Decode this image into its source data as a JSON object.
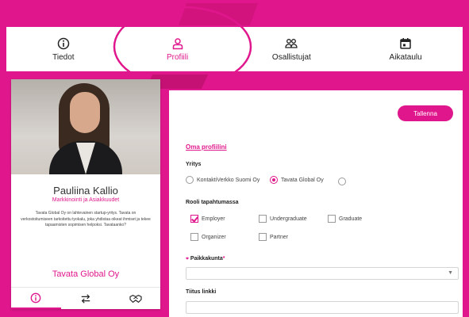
{
  "nav": {
    "items": [
      {
        "label": "Tiedot",
        "icon": "info-icon"
      },
      {
        "label": "Profiili",
        "icon": "user-icon"
      },
      {
        "label": "Osallistujat",
        "icon": "users-icon"
      },
      {
        "label": "Aikataulu",
        "icon": "calendar-icon"
      }
    ],
    "active_index": 1
  },
  "profile": {
    "name": "Pauliina Kallio",
    "title": "Markkinointi ja Asiakkuudet",
    "description": "Tavata Global Oy on lahtevainen startup-yritys. Tavata on verkostoitumiseen tarkoitettu tyokalu, joka yhdistaa oikeat ihmiset ja tekee tapaamisten sopimisen helpoksi. Tavataanko?",
    "company": "Tavata Global Oy"
  },
  "card_tabs": [
    "info-icon",
    "transfer-icon",
    "handshake-icon"
  ],
  "form": {
    "save_label": "Tallenna",
    "section_title": "Oma profiilini",
    "company_label": "Yritys",
    "company_options": [
      "KontaktiVerkko Suomi Oy",
      "Tavata Global Oy",
      ""
    ],
    "company_selected": 1,
    "role_label": "Rooli tapahtumassa",
    "roles": [
      {
        "label": "Employer",
        "checked": true
      },
      {
        "label": "Undergraduate",
        "checked": false
      },
      {
        "label": "Graduate",
        "checked": false
      },
      {
        "label": "Organizer",
        "checked": false
      },
      {
        "label": "Partner",
        "checked": false
      }
    ],
    "location_label_prefix": "⌖",
    "location_label": "Paikkakunta",
    "location_required": "*",
    "location_value": "",
    "link_label": "Tiitus linkki",
    "link_value": ""
  },
  "colors": {
    "accent": "#e0178c"
  }
}
